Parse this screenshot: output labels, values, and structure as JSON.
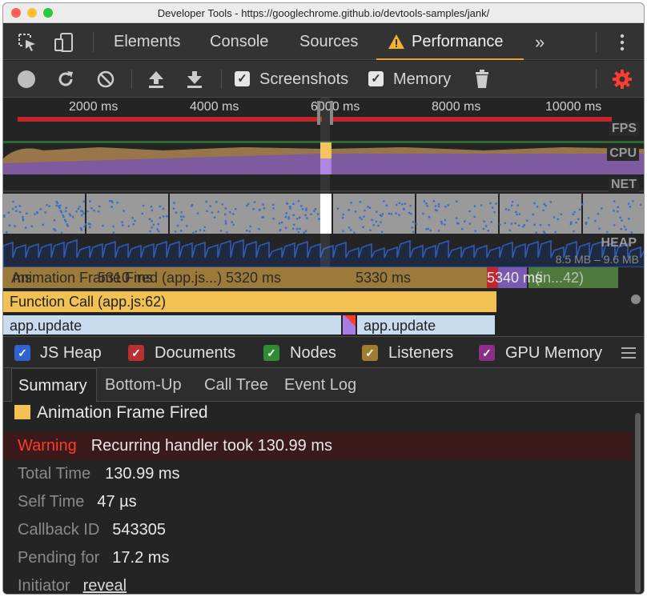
{
  "window": {
    "title": "Developer Tools - https://googlechrome.github.io/devtools-samples/jank/"
  },
  "tabs": {
    "items": [
      "Elements",
      "Console",
      "Sources",
      "Performance"
    ],
    "active": "Performance",
    "more": "»"
  },
  "toolbar": {
    "screenshots_label": "Screenshots",
    "memory_label": "Memory",
    "screenshots_checked": true,
    "memory_checked": true
  },
  "overview": {
    "ruler_ticks": [
      "2000 ms",
      "4000 ms",
      "6000 ms",
      "8000 ms",
      "10000 ms"
    ],
    "fps_label": "FPS",
    "cpu_label": "CPU",
    "net_label": "NET",
    "heap_label": "HEAP",
    "heap_range": "8.5 MB – 9.6 MB"
  },
  "flame": {
    "ruler_ticks": [
      "ms",
      "5310 ms",
      "5320 ms",
      "5330 ms",
      "5340 ms"
    ],
    "animation_frame": "Animation Frame Fired (app.js...)",
    "side_event": "(in...42)",
    "function_call": "Function Call (app.js:62)",
    "update_left": "app.update",
    "update_right": "app.update"
  },
  "counters": {
    "items": [
      {
        "label": "JS Heap",
        "color": "#3063ce",
        "checked": true
      },
      {
        "label": "Documents",
        "color": "#b83132",
        "checked": true
      },
      {
        "label": "Nodes",
        "color": "#2f8c35",
        "checked": true
      },
      {
        "label": "Listeners",
        "color": "#a27c31",
        "checked": true
      },
      {
        "label": "GPU Memory",
        "color": "#8d2e8d",
        "checked": true
      }
    ]
  },
  "subtabs": {
    "items": [
      "Summary",
      "Bottom-Up",
      "Call Tree",
      "Event Log"
    ],
    "active": "Summary"
  },
  "summary": {
    "title": "Animation Frame Fired",
    "warning_label": "Warning",
    "warning_text": "Recurring handler took 130.99 ms",
    "total_time_label": "Total Time",
    "total_time": "130.99 ms",
    "self_time_label": "Self Time",
    "self_time": "47 µs",
    "callback_id_label": "Callback ID",
    "callback_id": "543305",
    "pending_label": "Pending for",
    "pending": "17.2 ms",
    "initiator_label": "Initiator",
    "initiator_link": "reveal"
  },
  "colors": {
    "accent_orange": "#f0a135",
    "warning_red": "#ff3b2f",
    "settings_red": "#ff3c30",
    "scripting_yellow": "#f2c153",
    "update_blue": "#c9dbef"
  }
}
